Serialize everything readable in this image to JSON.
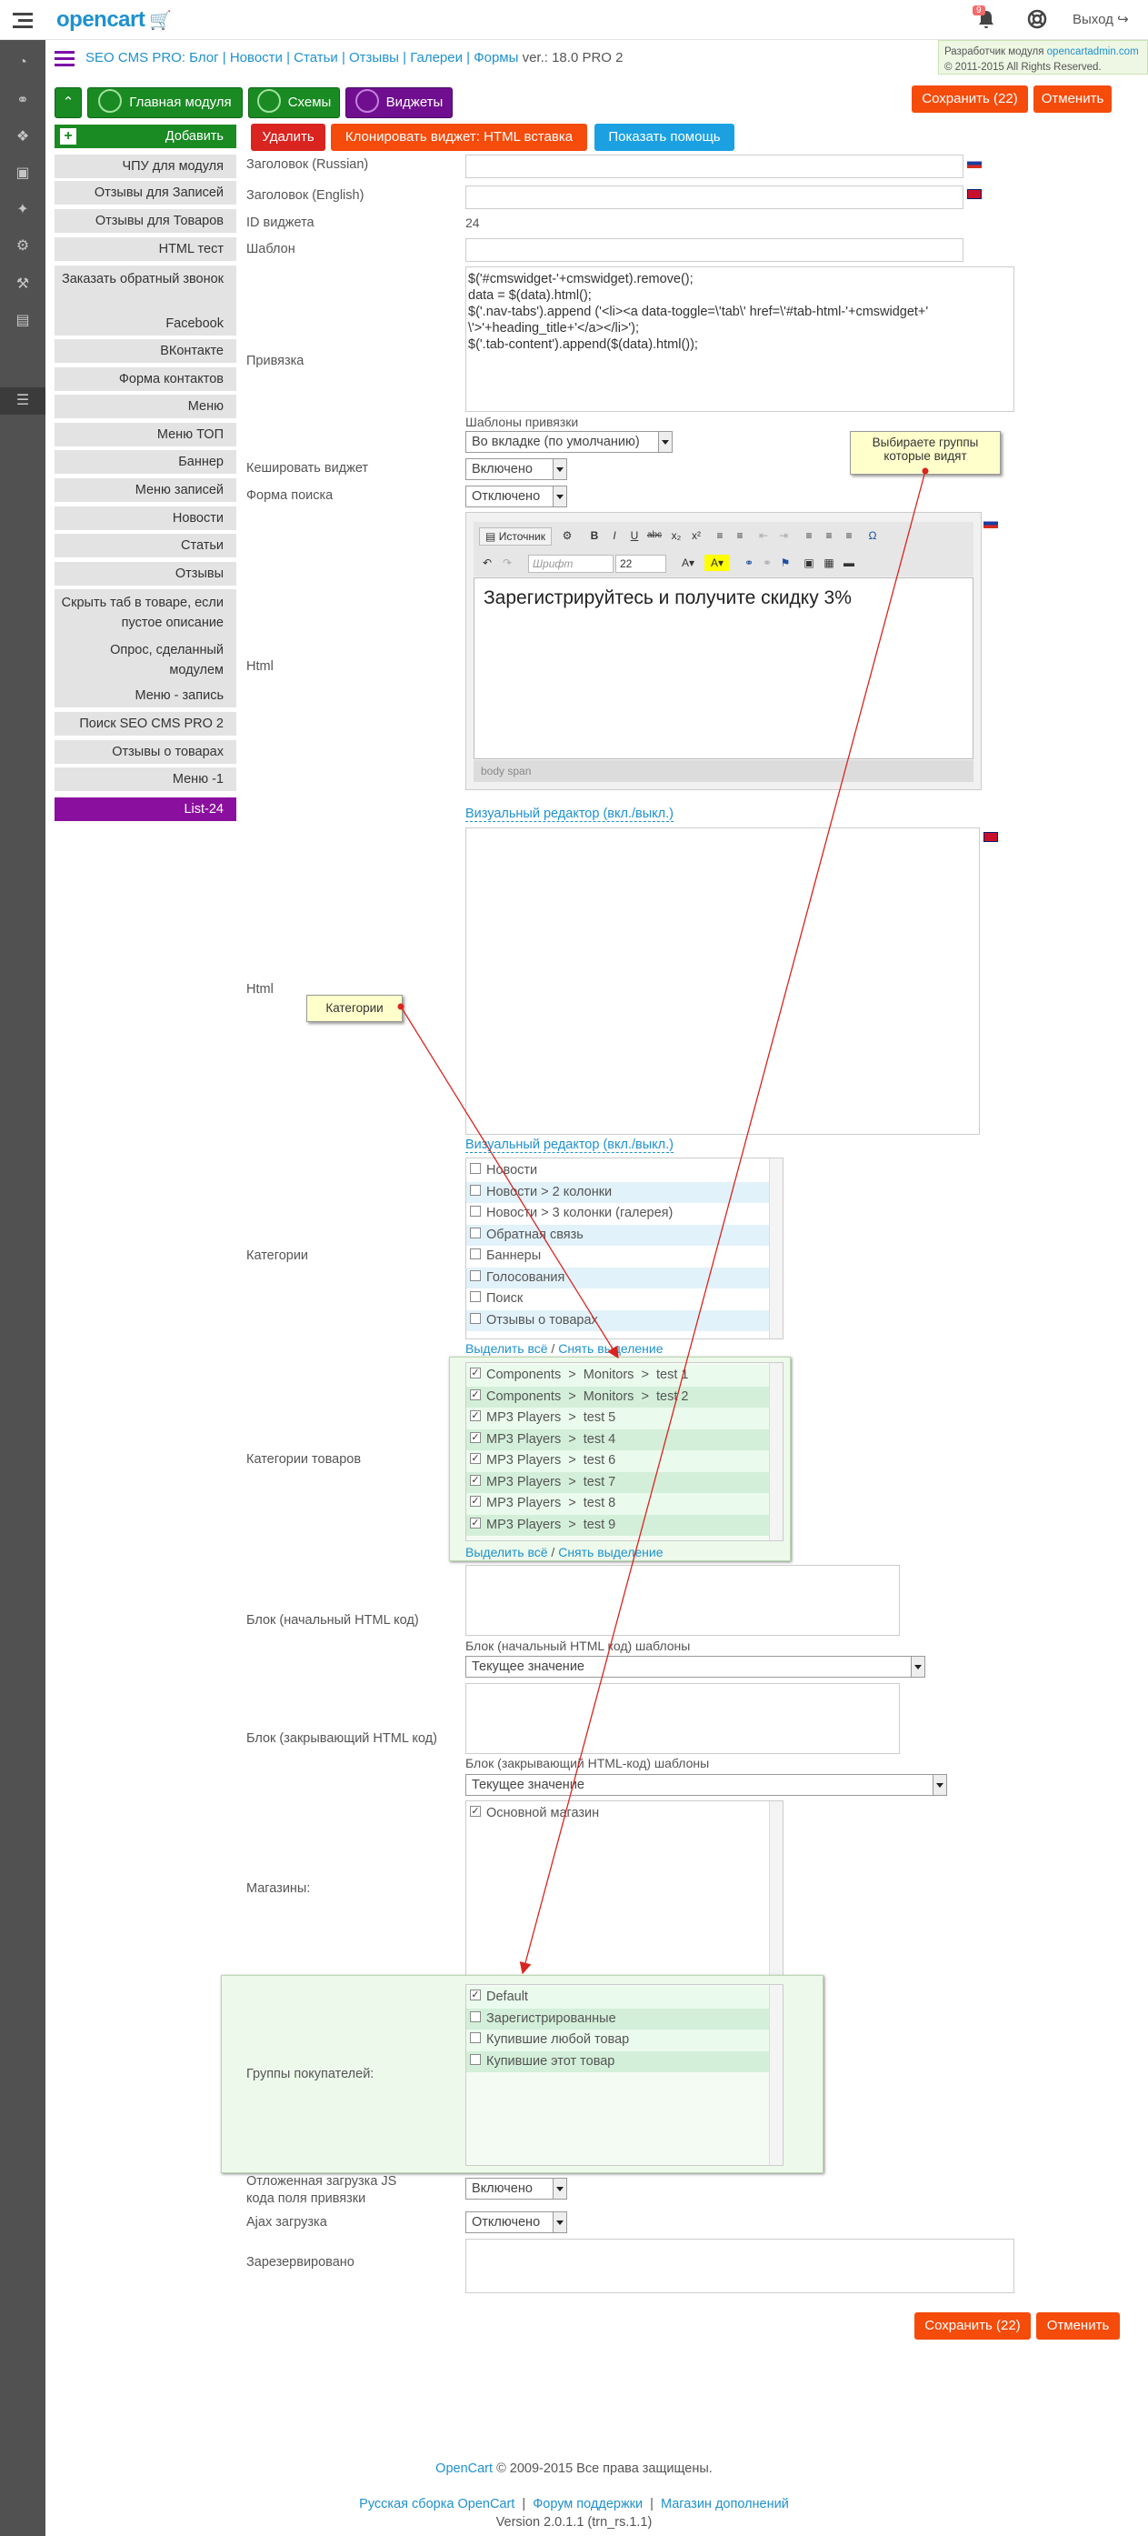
{
  "header": {
    "logo_text": "opencart",
    "bell_badge": "9",
    "logout": "Выход"
  },
  "module": {
    "title_links": [
      "SEO CMS PRO: Блог",
      "Новости",
      "Статьи",
      "Отзывы",
      "Галереи",
      "Формы"
    ],
    "version": "ver.: 18.0 PRO 2",
    "developer_label": "Разработчик модуля",
    "developer_link": "opencartadmin.com",
    "copyright": "© 2011-2015 All Rights Reserved."
  },
  "toolbar": {
    "save": "Сохранить (22)",
    "cancel": "Отменить",
    "main_module": "Главная модуля",
    "schemes": "Схемы",
    "widgets": "Виджеты",
    "delete": "Удалить",
    "clone": "Клонировать виджет: HTML вставка",
    "help": "Показать помощь"
  },
  "sidebar_menu": {
    "add": "Добавить",
    "items": [
      "ЧПУ для модуля",
      "Отзывы для Записей",
      "Отзывы для Товаров",
      "HTML тест",
      "Заказать обратный звонок",
      "Facebook",
      "ВКонтакте",
      "Форма контактов",
      "Меню",
      "Меню ТОП",
      "Баннер",
      "Меню записей",
      "Новости",
      "Статьи",
      "Отзывы",
      "Скрыть таб в товаре, если пустое описание",
      "Опрос, сделанный модулем",
      "Меню - запись",
      "Поиск SEO CMS PRO 2",
      "Отзывы о товарах",
      "Меню -1",
      "List-24"
    ]
  },
  "form": {
    "title_ru_label": "Заголовок (Russian)",
    "title_en_label": "Заголовок (English)",
    "widget_id_label": "ID виджета",
    "widget_id_value": "24",
    "template_label": "Шаблон",
    "binding_label": "Привязка",
    "binding_code": "$('#cmswidget-'+cmswidget).remove();\ndata = $(data).html();\n$('.nav-tabs').append ('<li><a data-toggle=\\'tab\\' href=\\'#tab-html-'+cmswidget+'\n\\'>'+heading_title+'</a></li>');\n$('.tab-content').append($(data).html());",
    "binding_templates_label": "Шаблоны привязки",
    "binding_templates_value": "Во вкладке (по умолчанию)",
    "cache_label": "Кешировать виджет",
    "cache_value": "Включено",
    "search_form_label": "Форма поиска",
    "search_form_value": "Отключено",
    "html_label": "Html",
    "html_label_2": "Html",
    "editor_content": "Зарегистрируйтесь и получите скидку 3%",
    "editor_source": "Источник",
    "editor_font": "Шрифт",
    "editor_size": "22",
    "editor_status": "body   span",
    "visual_toggle": "Визуальный редактор (вкл./выкл.)",
    "visual_toggle_2": "Визуальный редактор (вкл./выкл.)",
    "categories_label": "Категории",
    "categories": [
      "Новости",
      "Новости > 2 колонки",
      "Новости > 3 колонки (галерея)",
      "Обратная связь",
      "Баннеры",
      "Голосования",
      "Поиск",
      "Отзывы о товарах"
    ],
    "select_all": "Выделить всё",
    "deselect": "Снять выделение",
    "select_all_2": "Выделить всё",
    "deselect_2": "Снять выделение",
    "product_categories_label": "Категории товаров",
    "product_categories": [
      "Components  >  Monitors  >  test 1",
      "Components  >  Monitors  >  test 2",
      "MP3 Players  >  test 5",
      "MP3 Players  >  test 4",
      "MP3 Players  >  test 6",
      "MP3 Players  >  test 7",
      "MP3 Players  >  test 8",
      "MP3 Players  >  test 9"
    ],
    "block_open_label": "Блок (начальный HTML код)",
    "block_open_templates_label": "Блок (начальный HTML код) шаблоны",
    "block_open_templates_value": "Текущее значение",
    "block_close_label": "Блок (закрывающий HTML код)",
    "block_close_templates_label": "Блок (закрывающий HTML-код) шаблоны",
    "block_close_templates_value": "Текущее значение",
    "stores_label": "Магазины:",
    "stores": [
      "Основной магазин"
    ],
    "groups_label": "Группы покупателей:",
    "groups": [
      "Default",
      "Зарегистрированные",
      "Купившие любой товар",
      "Купившие этот товар"
    ],
    "deferred_js_label": "Отложенная загрузка JS кода поля привязки",
    "deferred_js_value": "Включено",
    "ajax_label": "Ajax загрузка",
    "ajax_value": "Отключено",
    "reserved_label": "Зарезервировано"
  },
  "callouts": {
    "groups_note": "Выбираете группы которые видят",
    "categories_note": "Категории"
  },
  "footer": {
    "copyright_link": "OpenCart",
    "copyright_rest": " © 2009-2015 Все права защищены.",
    "links": [
      "Русская сборка OpenCart",
      "Форум поддержки",
      "Магазин дополнений"
    ],
    "version": "Version 2.0.1.1 (trn_rs.1.1)"
  },
  "colors": {
    "accent_blue": "#1e91cf",
    "orange": "#f54b0b",
    "purple": "#8a0f9e",
    "green": "#1a8a23"
  }
}
